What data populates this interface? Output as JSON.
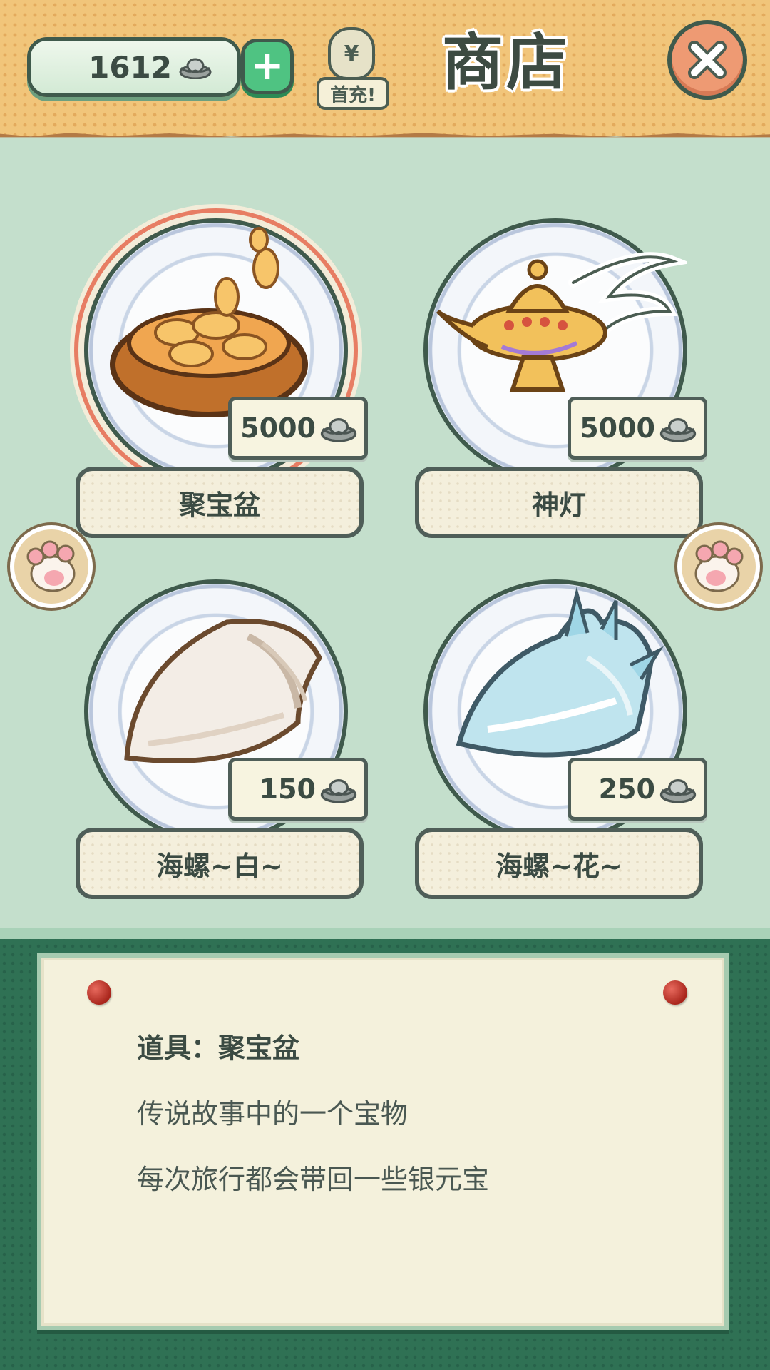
{
  "header": {
    "currency_value": "1612",
    "add_label": "+",
    "first_charge_label": "首充!",
    "first_charge_bag_symbol": "¥",
    "title": "商店",
    "close_icon": "close-x-icon"
  },
  "items": [
    {
      "name": "聚宝盆",
      "price": "5000",
      "icon": "treasure-bowl-icon",
      "selected": true
    },
    {
      "name": "神灯",
      "price": "5000",
      "icon": "magic-lamp-icon",
      "selected": false
    },
    {
      "name": "海螺~白~",
      "price": "150",
      "icon": "white-conch-icon",
      "selected": false
    },
    {
      "name": "海螺~花~",
      "price": "250",
      "icon": "blue-conch-icon",
      "selected": false
    }
  ],
  "paw_buttons": {
    "left_icon": "paw-prev-icon",
    "right_icon": "paw-next-icon"
  },
  "description": {
    "title": "道具：聚宝盆",
    "lines": [
      "传说故事中的一个宝物",
      "每次旅行都会带回一些银元宝"
    ]
  },
  "colors": {
    "header_bg": "#f1c57a",
    "page_bg": "#c4dfcc",
    "board_bg": "#2f7154",
    "accent_green": "#4fc382",
    "close_orange": "#ee9a73"
  }
}
